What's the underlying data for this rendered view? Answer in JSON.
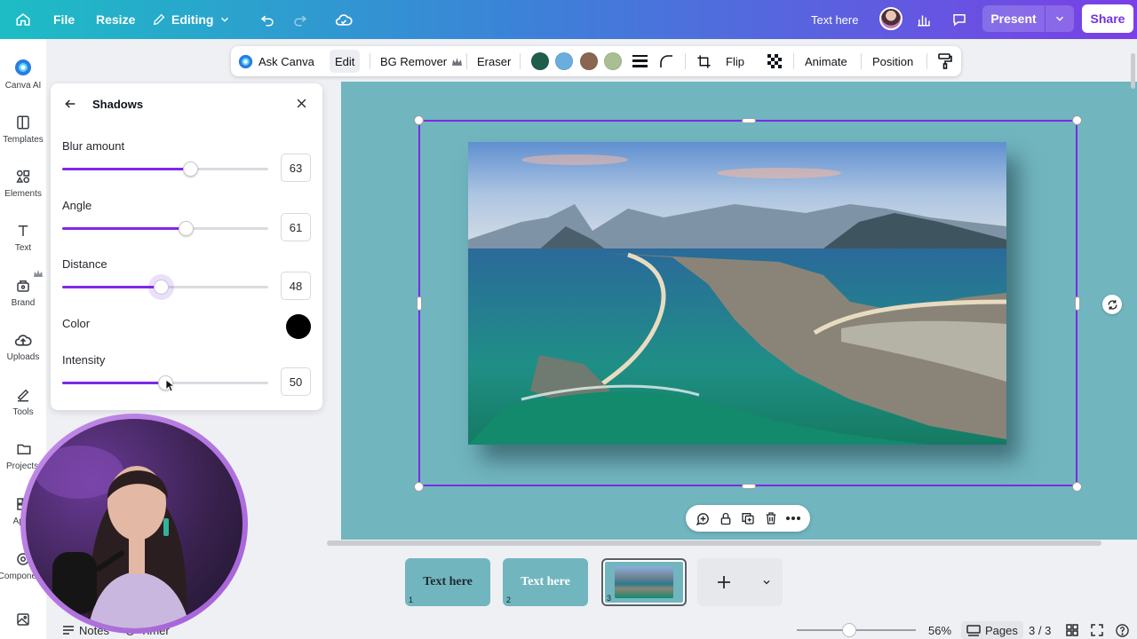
{
  "topbar": {
    "file_label": "File",
    "resize_label": "Resize",
    "editing_label": "Editing",
    "doc_title": "Text here",
    "present_label": "Present",
    "share_label": "Share",
    "accent_start": "#1dbdc4",
    "accent_end": "#7a3fe6"
  },
  "rail": {
    "items": [
      {
        "label": "Canva AI",
        "icon": "canva-ai-icon"
      },
      {
        "label": "Templates",
        "icon": "templates-icon"
      },
      {
        "label": "Elements",
        "icon": "elements-icon"
      },
      {
        "label": "Text",
        "icon": "text-icon"
      },
      {
        "label": "Brand",
        "icon": "brand-icon"
      },
      {
        "label": "Uploads",
        "icon": "uploads-icon"
      },
      {
        "label": "Tools",
        "icon": "tools-icon"
      },
      {
        "label": "Projects",
        "icon": "projects-icon"
      },
      {
        "label": "Apps",
        "icon": "apps-icon"
      },
      {
        "label": "Components",
        "icon": "components-icon"
      }
    ]
  },
  "context_toolbar": {
    "ask_canva": "Ask Canva",
    "edit": "Edit",
    "bg_remover": "BG Remover",
    "eraser": "Eraser",
    "flip": "Flip",
    "animate": "Animate",
    "position": "Position",
    "swatches": [
      "#1f5e4b",
      "#6aaedf",
      "#8a6550",
      "#a8bf92"
    ]
  },
  "shadows_panel": {
    "title": "Shadows",
    "blur": {
      "label": "Blur amount",
      "value": "63",
      "fraction": 0.62
    },
    "angle": {
      "label": "Angle",
      "value": "61",
      "fraction": 0.6
    },
    "distance": {
      "label": "Distance",
      "value": "48",
      "fraction": 0.48
    },
    "color": {
      "label": "Color",
      "swatch": "#000000"
    },
    "intensity": {
      "label": "Intensity",
      "value": "50",
      "fraction": 0.5
    },
    "slider_color": "#7d2ae8"
  },
  "canvas": {
    "background": "#71b5bf"
  },
  "pages": {
    "thumbs": [
      {
        "text": "Text here",
        "number": "1"
      },
      {
        "text": "Text here",
        "number": "2"
      },
      {
        "text": "",
        "number": "3"
      }
    ]
  },
  "status": {
    "notes_label": "Notes",
    "timer_label": "Timer",
    "zoom": "56%",
    "pages_label": "Pages",
    "page_count": "3 / 3"
  }
}
